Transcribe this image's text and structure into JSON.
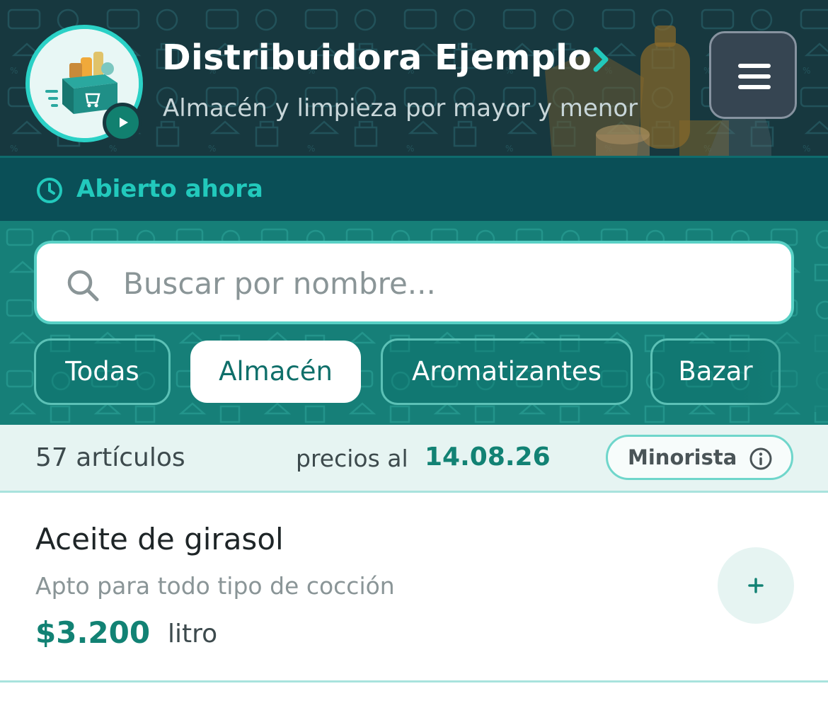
{
  "header": {
    "store_name": "Distribuidora Ejemplo",
    "tagline": "Almacén y limpieza por mayor y menor",
    "logo_icon": "grocery-box-cart-icon",
    "play_icon": "play-icon",
    "chevron_icon": "chevron-right-icon",
    "menu_icon": "hamburger-menu-icon"
  },
  "status": {
    "icon": "clock-icon",
    "text": "Abierto ahora"
  },
  "search": {
    "placeholder": "Buscar por nombre...",
    "value": "",
    "icon": "search-icon"
  },
  "categories": {
    "items": [
      "Todas",
      "Almacén",
      "Aromatizantes",
      "Bazar"
    ],
    "selected": "Almacén"
  },
  "info": {
    "count_text": "57 artículos",
    "prices_label": "precios al",
    "prices_date": "14.08.26",
    "mode": "Minorista",
    "mode_icon": "info-icon"
  },
  "products": [
    {
      "name": "Aceite de girasol",
      "description": "Apto para todo tipo de cocción",
      "price": "$3.200",
      "unit": "litro",
      "add_icon": "plus-icon"
    }
  ],
  "colors": {
    "header_bg": "#17383f",
    "status_bg": "#0a4f57",
    "accent": "#22c9bc",
    "search_area_bg": "#167f78",
    "price_green": "#128274",
    "info_bar_bg": "#e6f4f2"
  }
}
